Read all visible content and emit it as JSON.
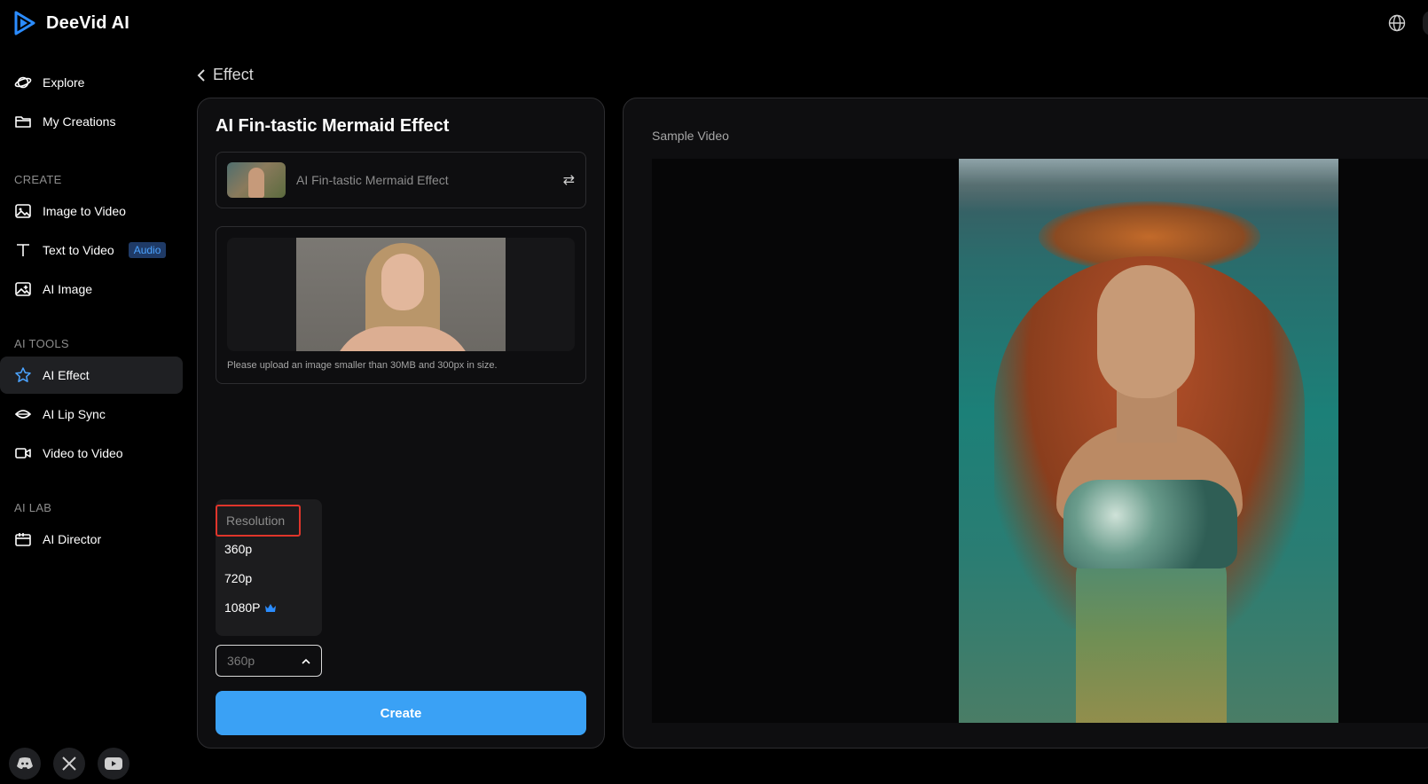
{
  "app": {
    "name": "DeeVid AI"
  },
  "sidebar": {
    "top_items": [
      {
        "label": "Explore",
        "icon": "planet-icon"
      },
      {
        "label": "My Creations",
        "icon": "folder-icon"
      }
    ],
    "sections": [
      {
        "label": "CREATE",
        "items": [
          {
            "label": "Image to Video",
            "icon": "image-icon"
          },
          {
            "label": "Text to Video",
            "icon": "text-icon",
            "badge": "Audio"
          },
          {
            "label": "AI Image",
            "icon": "ai-image-icon"
          }
        ]
      },
      {
        "label": "AI TOOLS",
        "items": [
          {
            "label": "AI Effect",
            "icon": "star-icon",
            "active": true
          },
          {
            "label": "AI Lip Sync",
            "icon": "lips-icon"
          },
          {
            "label": "Video to Video",
            "icon": "video-camera-icon"
          }
        ]
      },
      {
        "label": "AI LAB",
        "items": [
          {
            "label": "AI Director",
            "icon": "clapperboard-icon"
          }
        ]
      }
    ],
    "socials": [
      "discord-icon",
      "x-icon",
      "youtube-icon"
    ]
  },
  "breadcrumb": {
    "back_label": "Effect"
  },
  "panel": {
    "title": "AI Fin-tastic Mermaid Effect",
    "effect_name": "AI Fin-tastic Mermaid Effect",
    "upload_hint": "Please upload an image smaller than 30MB and 300px in size.",
    "resolution": {
      "header": "Resolution",
      "options": [
        "360p",
        "720p",
        "1080P"
      ],
      "premium_option": "1080P",
      "selected": "360p"
    },
    "create_label": "Create"
  },
  "sample": {
    "label": "Sample Video"
  },
  "colors": {
    "accent": "#3aa1f5",
    "highlight_border": "#e0352b",
    "badge_text": "#4ba3ff"
  }
}
